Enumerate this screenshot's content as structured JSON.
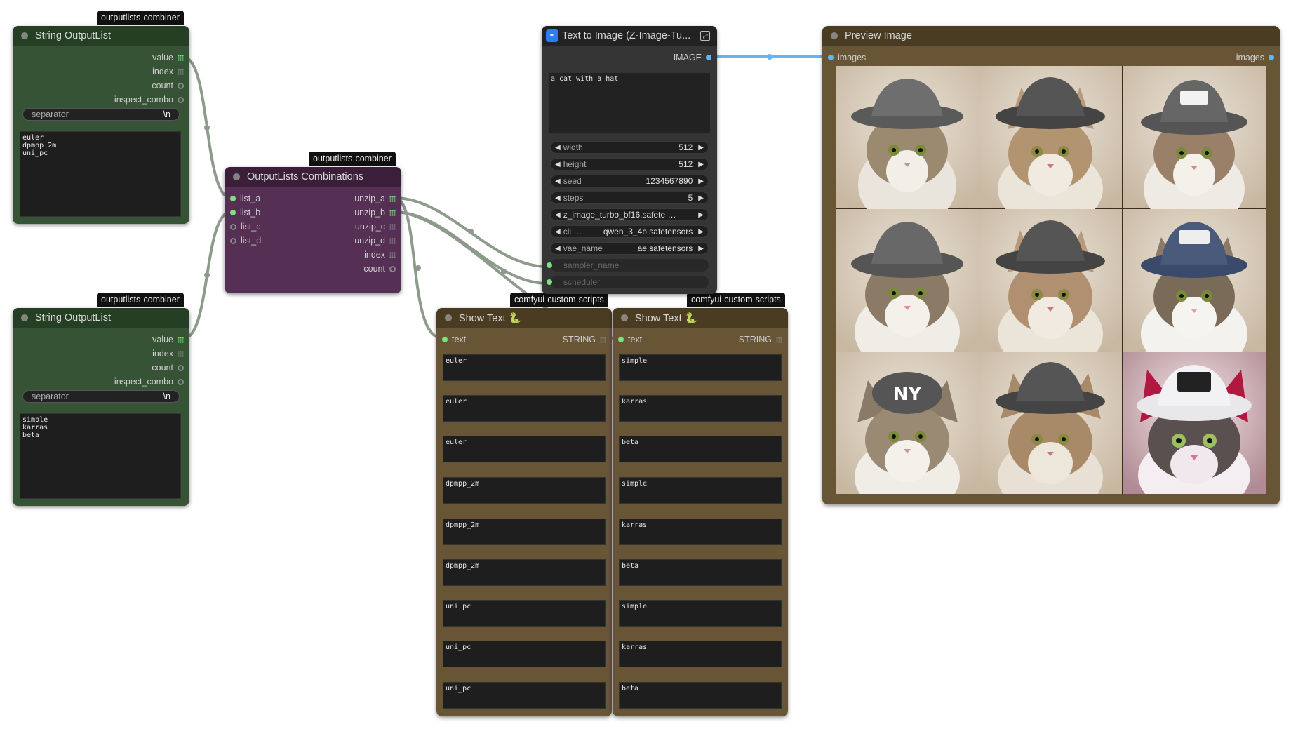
{
  "tags": {
    "string_list_1": "outputlists-combiner",
    "string_list_2": "outputlists-combiner",
    "combinations": "outputlists-combiner",
    "show_text_1": "comfyui-custom-scripts",
    "show_text_2": "comfyui-custom-scripts"
  },
  "string_list_1": {
    "title": "String OutputList",
    "outputs": [
      "value",
      "index",
      "count",
      "inspect_combo"
    ],
    "separator_label": "separator",
    "separator_value": "\\n",
    "text": "euler\ndpmpp_2m\nuni_pc"
  },
  "string_list_2": {
    "title": "String OutputList",
    "outputs": [
      "value",
      "index",
      "count",
      "inspect_combo"
    ],
    "separator_label": "separator",
    "separator_value": "\\n",
    "text": "simple\nkarras\nbeta"
  },
  "combinations": {
    "title": "OutputLists Combinations",
    "inputs": [
      "list_a",
      "list_b",
      "list_c",
      "list_d"
    ],
    "outputs": [
      "unzip_a",
      "unzip_b",
      "unzip_c",
      "unzip_d",
      "index",
      "count"
    ]
  },
  "text_to_image": {
    "title": "Text to Image (Z-Image-Tu...",
    "output": "IMAGE",
    "prompt": "a cat with a hat",
    "widgets": [
      {
        "label": "width",
        "value": "512"
      },
      {
        "label": "height",
        "value": "512"
      },
      {
        "label": "seed",
        "value": "1234567890"
      },
      {
        "label": "steps",
        "value": "5"
      },
      {
        "label": "",
        "value": "z_image_turbo_bf16.safete …"
      },
      {
        "label": "cli …",
        "value": "qwen_3_4b.safetensors"
      },
      {
        "label": "vae_name",
        "value": "ae.safetensors"
      }
    ],
    "inputs": [
      "sampler_name",
      "scheduler"
    ]
  },
  "preview": {
    "title": "Preview Image",
    "input": "images",
    "output": "images"
  },
  "show_text_1": {
    "title": "Show Text 🐍",
    "input": "text",
    "output": "STRING",
    "values": [
      "euler",
      "euler",
      "euler",
      "dpmpp_2m",
      "dpmpp_2m",
      "dpmpp_2m",
      "uni_pc",
      "uni_pc",
      "uni_pc"
    ]
  },
  "show_text_2": {
    "title": "Show Text 🐍",
    "input": "text",
    "output": "STRING",
    "values": [
      "simple",
      "karras",
      "beta",
      "simple",
      "karras",
      "beta",
      "simple",
      "karras",
      "beta"
    ]
  },
  "colors": {
    "green_node": "#365435",
    "purple_node": "#553054",
    "brown_node": "#675536",
    "dark_node": "#353535",
    "link_gray": "#8a9a8a",
    "link_blue": "#64b5f6"
  }
}
